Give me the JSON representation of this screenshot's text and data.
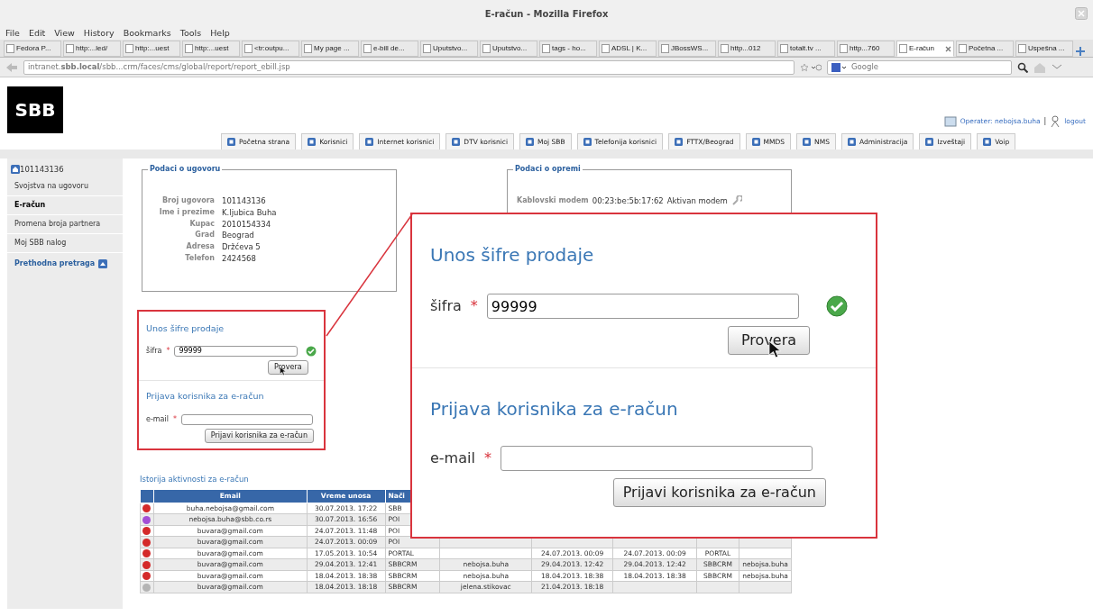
{
  "window": {
    "title": "E-račun - Mozilla Firefox"
  },
  "menu": [
    "File",
    "Edit",
    "View",
    "History",
    "Bookmarks",
    "Tools",
    "Help"
  ],
  "browser_tabs": [
    {
      "label": "Fedora P...",
      "selected": false
    },
    {
      "label": "http:...led/",
      "selected": false
    },
    {
      "label": "http:...uest",
      "selected": false
    },
    {
      "label": "http:...uest",
      "selected": false
    },
    {
      "label": "<tr:outpu...",
      "selected": false
    },
    {
      "label": "My page ...",
      "selected": false
    },
    {
      "label": "e-bill de...",
      "selected": false
    },
    {
      "label": "Uputstvo...",
      "selected": false
    },
    {
      "label": "Uputstvo...",
      "selected": false
    },
    {
      "label": "tags - ho...",
      "selected": false
    },
    {
      "label": "ADSL | K...",
      "selected": false
    },
    {
      "label": "JBossWS...",
      "selected": false
    },
    {
      "label": "http...012",
      "selected": false
    },
    {
      "label": "totalt.tv ...",
      "selected": false
    },
    {
      "label": "http...760",
      "selected": false
    },
    {
      "label": "E-račun",
      "selected": true
    },
    {
      "label": "Početna ...",
      "selected": false
    },
    {
      "label": "Uspešna ...",
      "selected": false
    }
  ],
  "address_bar": {
    "url": "intranet.**sbb.local**/sbb...crm/faces/cms/global/report/report_ebill.jsp"
  },
  "search": {
    "placeholder": "Google"
  },
  "logo": "SBB",
  "operator": {
    "label": "Operater: nebojsa.buha",
    "separator": "|",
    "logout": "logout"
  },
  "nav_tabs": [
    "Početna strana",
    "Korisnici",
    "Internet korisnici",
    "DTV korisnici",
    "Moj SBB",
    "Telefonija korisnici",
    "FTTX/Beograd",
    "MMDS",
    "NMS",
    "Administracija",
    "Izveštaji",
    "Voip"
  ],
  "sidebar": {
    "title": "101143136",
    "items": [
      {
        "label": "Svojstva na ugovoru",
        "selected": false
      },
      {
        "label": "E-račun",
        "selected": true
      },
      {
        "label": "Promena broja partnera",
        "selected": false
      },
      {
        "label": "Moj SBB nalog",
        "selected": false
      }
    ],
    "back_link": "Prethodna pretraga"
  },
  "contract": {
    "title": "Podaci o ugovoru",
    "fields": [
      {
        "label": "Broj ugovora",
        "value": "101143136"
      },
      {
        "label": "Ime i prezime",
        "value": "K.ljubica Buha"
      },
      {
        "label": "Kupac",
        "value": "2010154334"
      },
      {
        "label": "Grad",
        "value": "Beograd"
      },
      {
        "label": "Adresa",
        "value": "Držćeva 5"
      },
      {
        "label": "Telefon",
        "value": "2424568"
      }
    ]
  },
  "equipment": {
    "title": "Podaci o opremi",
    "label": "Kablovski modem",
    "mac": "00:23:be:5b:17:62",
    "status": "Aktivan modem"
  },
  "form_panel": {
    "sale_code_form": {
      "title": "Unos šifre prodaje",
      "label": "šifra",
      "required": "*",
      "value": "99999",
      "valid": true,
      "button": "Provera"
    },
    "registration_form": {
      "title": "Prijava korisnika za e-račun",
      "label": "e-mail",
      "required": "*",
      "button": "Prijavi korisnika za e-račun"
    }
  },
  "zoomed_form_panel": {
    "sale_code_form": {
      "title": "Unos šifre prodaje",
      "label": "šifra",
      "required": "*",
      "value": "99999",
      "valid": true,
      "button": "Provera"
    },
    "registration_form": {
      "title": "Prijava korisnika za e-račun",
      "label": "e-mail",
      "required": "*",
      "button": "Prijavi korisnika za e-račun"
    }
  },
  "history": {
    "title": "Istorija aktivnosti za e-račun",
    "columns": [
      "Email",
      "Vreme unosa",
      "Nači"
    ],
    "rows": [
      {
        "color": "#d42a2a",
        "cells": [
          "buha.nebojsa@gmail.com",
          "30.07.2013. 17:22",
          "SBB"
        ]
      },
      {
        "color": "#a34fd6",
        "cells": [
          "nebojsa.buha@sbb.co.rs",
          "30.07.2013. 16:56",
          "POI"
        ]
      },
      {
        "color": "#d42a2a",
        "cells": [
          "buvara@gmail.com",
          "24.07.2013. 11:48",
          "POI"
        ]
      },
      {
        "color": "#d42a2a",
        "cells": [
          "buvara@gmail.com",
          "24.07.2013. 00:09",
          "POI"
        ]
      },
      {
        "color": "#d42a2a",
        "cells": [
          "buvara@gmail.com",
          "17.05.2013. 10:54",
          "PORTAL",
          "",
          "24.07.2013. 00:09",
          "24.07.2013. 00:09",
          "PORTAL",
          ""
        ]
      },
      {
        "color": "#d42a2a",
        "cells": [
          "buvara@gmail.com",
          "29.04.2013. 12:41",
          "SBBCRM",
          "nebojsa.buha",
          "29.04.2013. 12:42",
          "29.04.2013. 12:42",
          "SBBCRM",
          "nebojsa.buha"
        ]
      },
      {
        "color": "#d42a2a",
        "cells": [
          "buvara@gmail.com",
          "18.04.2013. 18:38",
          "SBBCRM",
          "nebojsa.buha",
          "18.04.2013. 18:38",
          "18.04.2013. 18:38",
          "SBBCRM",
          "nebojsa.buha"
        ]
      },
      {
        "color": "#b4b4b4",
        "cells": [
          "buvara@gmail.com",
          "18.04.2013. 18:18",
          "SBBCRM",
          "jelena.stikovac",
          "21.04.2013. 18:18"
        ]
      }
    ]
  }
}
